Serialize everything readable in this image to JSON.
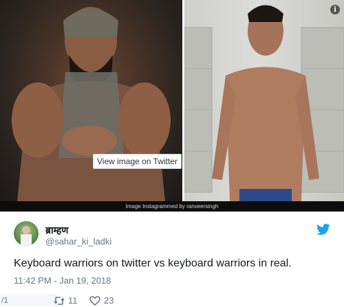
{
  "media": {
    "photo_left_alt": "",
    "photo_right_alt": "",
    "caption": "Image Instagrammed by ranveersingh",
    "info_icon": "info-icon",
    "view_on_twitter": "View image on Twitter"
  },
  "tweet": {
    "display_name": "ब्राम्हण",
    "handle": "@sahar_ki_ladki",
    "text": "Keyboard warriors on twitter vs keyboard warriors in real.",
    "timestamp": "11:42 PM - Jan 19, 2018"
  },
  "actions": {
    "reply_stub": "/1",
    "retweets": "11",
    "likes": "23"
  },
  "colors": {
    "twitter_blue": "#1da1f2",
    "meta_gray": "#657786",
    "text": "#14171a"
  }
}
